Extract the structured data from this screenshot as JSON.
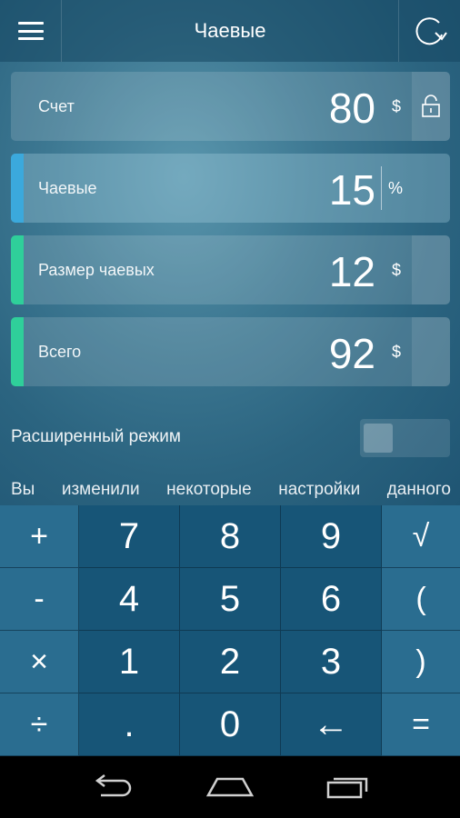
{
  "header": {
    "title": "Чаевые"
  },
  "fields": [
    {
      "label": "Счет",
      "value": "80",
      "unit": "$",
      "accent": "",
      "side_icon": "lock-icon"
    },
    {
      "label": "Чаевые",
      "value": "15",
      "unit": "%",
      "accent": "#3ba9dc",
      "side_icon": ""
    },
    {
      "label": "Размер чаевых",
      "value": "12",
      "unit": "$",
      "accent": "#2fcf9a",
      "side_icon": ""
    },
    {
      "label": "Всего",
      "value": "92",
      "unit": "$",
      "accent": "#2fcf9a",
      "side_icon": ""
    }
  ],
  "advanced": {
    "label": "Расширенный режим",
    "enabled": false
  },
  "notice": {
    "words": [
      "Вы",
      "изменили",
      "некоторые",
      "настройки",
      "данного"
    ]
  },
  "keypad": {
    "rows": [
      [
        "+",
        "7",
        "8",
        "9",
        "√"
      ],
      [
        "-",
        "4",
        "5",
        "6",
        "("
      ],
      [
        "×",
        "1",
        "2",
        "3",
        ")"
      ],
      [
        "÷",
        ".",
        "0",
        "←",
        "="
      ]
    ]
  },
  "navbar": {
    "icons": [
      "back-icon",
      "home-icon",
      "recent-apps-icon"
    ]
  },
  "colors": {
    "accent_blue": "#3ba9dc",
    "accent_green": "#2fcf9a",
    "keypad_num": "#175577",
    "keypad_op": "#2a6d90"
  }
}
